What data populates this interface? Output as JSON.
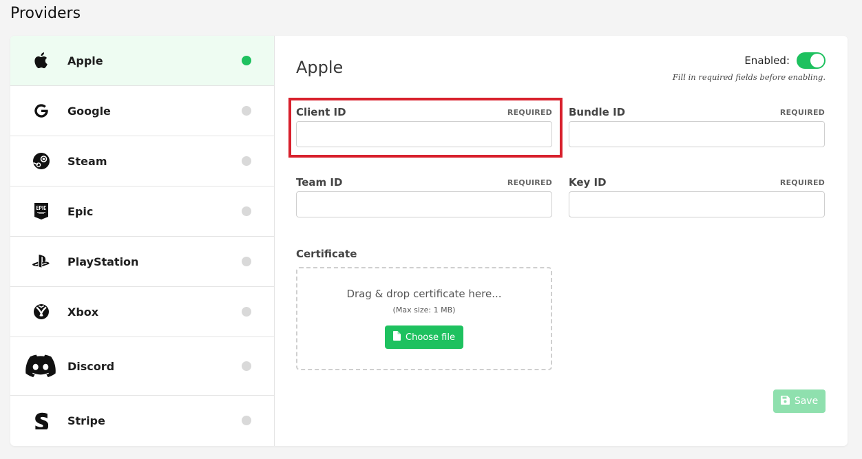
{
  "page": {
    "title": "Providers"
  },
  "sidebar": {
    "items": [
      {
        "label": "Apple",
        "icon": "apple-icon",
        "active": true,
        "status": "enabled"
      },
      {
        "label": "Google",
        "icon": "google-icon",
        "active": false,
        "status": "disabled"
      },
      {
        "label": "Steam",
        "icon": "steam-icon",
        "active": false,
        "status": "disabled"
      },
      {
        "label": "Epic",
        "icon": "epic-games-icon",
        "active": false,
        "status": "disabled"
      },
      {
        "label": "PlayStation",
        "icon": "playstation-icon",
        "active": false,
        "status": "disabled"
      },
      {
        "label": "Xbox",
        "icon": "xbox-icon",
        "active": false,
        "status": "disabled"
      },
      {
        "label": "Discord",
        "icon": "discord-icon",
        "active": false,
        "status": "disabled"
      },
      {
        "label": "Stripe",
        "icon": "stripe-icon",
        "active": false,
        "status": "disabled"
      }
    ]
  },
  "main": {
    "title": "Apple",
    "enabled_label": "Enabled:",
    "enabled": true,
    "hint": "Fill in required fields before enabling.",
    "fields": {
      "client_id": {
        "label": "Client ID",
        "required": "REQUIRED",
        "value": ""
      },
      "bundle_id": {
        "label": "Bundle ID",
        "required": "REQUIRED",
        "value": ""
      },
      "team_id": {
        "label": "Team ID",
        "required": "REQUIRED",
        "value": ""
      },
      "key_id": {
        "label": "Key ID",
        "required": "REQUIRED",
        "value": ""
      }
    },
    "certificate": {
      "label": "Certificate",
      "drop_text": "Drag & drop certificate here...",
      "max_size": "(Max size: 1 MB)",
      "button_label": "Choose file"
    },
    "save_label": "Save"
  },
  "colors": {
    "accent": "#1ec15f",
    "active_bg": "#eefcf2",
    "highlight": "#d8202c",
    "inactive_dot": "#d9d9d9"
  }
}
